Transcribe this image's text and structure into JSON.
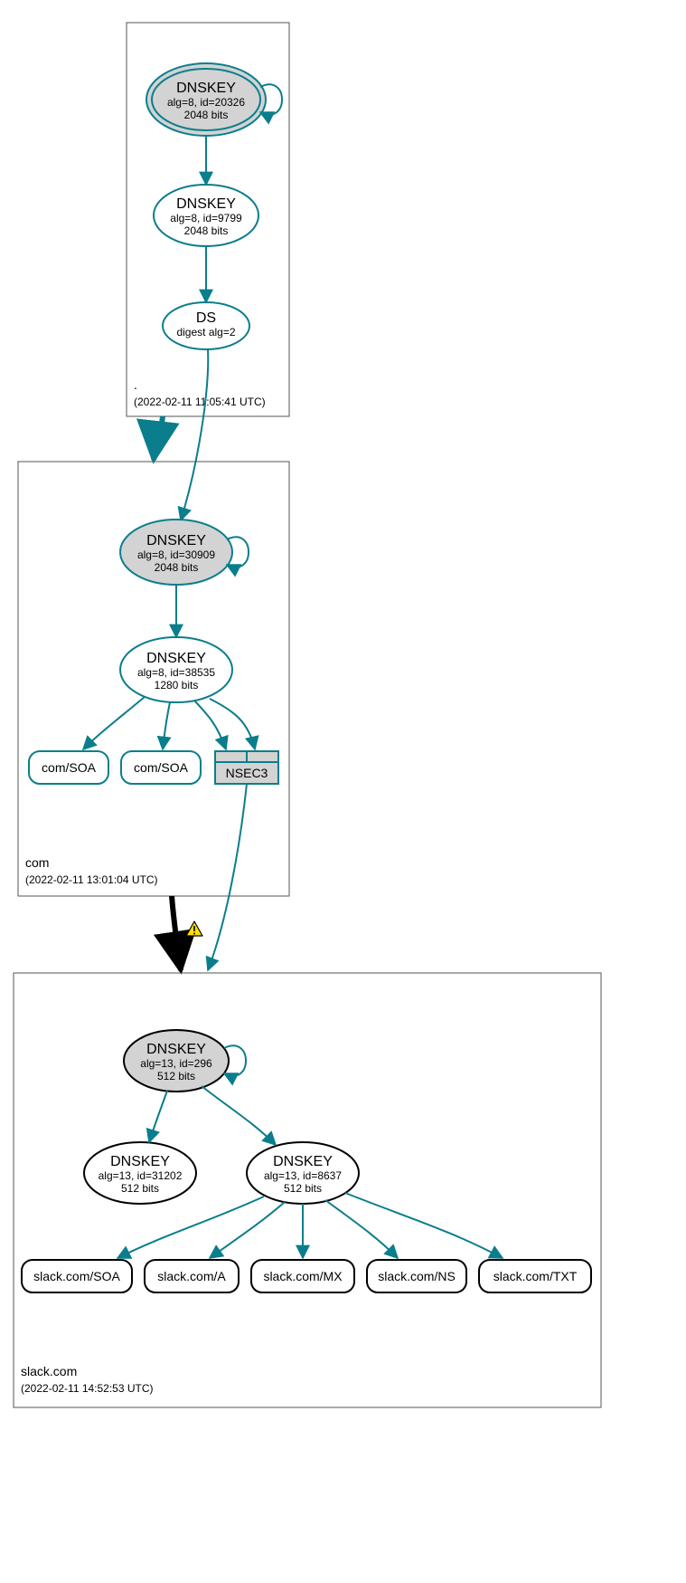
{
  "zones": {
    "root": {
      "label": ".",
      "timestamp": "(2022-02-11 11:05:41 UTC)",
      "nodes": {
        "key20326": {
          "title": "DNSKEY",
          "sub1": "alg=8, id=20326",
          "sub2": "2048 bits"
        },
        "key9799": {
          "title": "DNSKEY",
          "sub1": "alg=8, id=9799",
          "sub2": "2048 bits"
        },
        "ds": {
          "title": "DS",
          "sub1": "digest alg=2"
        }
      }
    },
    "com": {
      "label": "com",
      "timestamp": "(2022-02-11 13:01:04 UTC)",
      "nodes": {
        "key30909": {
          "title": "DNSKEY",
          "sub1": "alg=8, id=30909",
          "sub2": "2048 bits"
        },
        "key38535": {
          "title": "DNSKEY",
          "sub1": "alg=8, id=38535",
          "sub2": "1280 bits"
        },
        "soa1": {
          "label": "com/SOA"
        },
        "soa2": {
          "label": "com/SOA"
        },
        "nsec3": {
          "label": "NSEC3"
        }
      }
    },
    "slack": {
      "label": "slack.com",
      "timestamp": "(2022-02-11 14:52:53 UTC)",
      "nodes": {
        "key296": {
          "title": "DNSKEY",
          "sub1": "alg=13, id=296",
          "sub2": "512 bits"
        },
        "key31202": {
          "title": "DNSKEY",
          "sub1": "alg=13, id=31202",
          "sub2": "512 bits"
        },
        "key8637": {
          "title": "DNSKEY",
          "sub1": "alg=13, id=8637",
          "sub2": "512 bits"
        },
        "soa": {
          "label": "slack.com/SOA"
        },
        "a": {
          "label": "slack.com/A"
        },
        "mx": {
          "label": "slack.com/MX"
        },
        "ns": {
          "label": "slack.com/NS"
        },
        "txt": {
          "label": "slack.com/TXT"
        }
      }
    }
  },
  "colors": {
    "secure": "#0a7e8c",
    "black": "#000000",
    "grayFill": "#d3d3d3",
    "warnFill": "#ffdd00",
    "warnStroke": "#000000"
  }
}
